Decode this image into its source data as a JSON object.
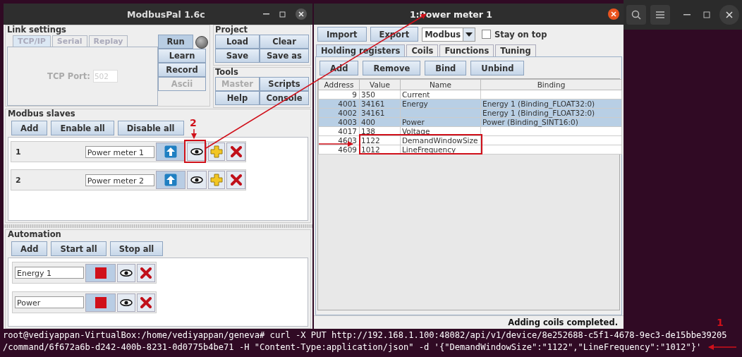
{
  "modbuspal": {
    "title": "ModbusPal 1.6c",
    "link_settings": {
      "title": "Link settings",
      "tabs": [
        {
          "label": "TCP/IP",
          "selected": true
        },
        {
          "label": "Serial",
          "selected": false
        },
        {
          "label": "Replay",
          "selected": false
        }
      ],
      "tcp_port_label": "TCP Port:",
      "tcp_port_value": "502",
      "buttons": [
        {
          "label": "Run",
          "pressed": true,
          "disabled": false
        },
        {
          "label": "Learn",
          "pressed": false,
          "disabled": false
        },
        {
          "label": "Record",
          "pressed": false,
          "disabled": false
        },
        {
          "label": "Ascii",
          "pressed": false,
          "disabled": true
        }
      ]
    },
    "project": {
      "title": "Project",
      "buttons": [
        {
          "label": "Load",
          "disabled": false
        },
        {
          "label": "Clear",
          "disabled": false
        },
        {
          "label": "Save",
          "disabled": false
        },
        {
          "label": "Save as",
          "disabled": false
        }
      ]
    },
    "tools": {
      "title": "Tools",
      "buttons": [
        {
          "label": "Master",
          "disabled": true
        },
        {
          "label": "Scripts",
          "disabled": false
        },
        {
          "label": "Help",
          "disabled": false
        },
        {
          "label": "Console",
          "disabled": false
        }
      ]
    },
    "slaves": {
      "title": "Modbus slaves",
      "buttons": [
        "Add",
        "Enable all",
        "Disable all"
      ],
      "items": [
        {
          "number": "1",
          "name": "Power meter 1"
        },
        {
          "number": "2",
          "name": "Power meter 2"
        }
      ]
    },
    "automation": {
      "title": "Automation",
      "buttons": [
        "Add",
        "Start all",
        "Stop all"
      ],
      "items": [
        {
          "name": "Energy 1"
        },
        {
          "name": "Power"
        }
      ]
    }
  },
  "power_meter": {
    "title": "1:Power meter 1",
    "toolbar": {
      "buttons": [
        "Import",
        "Export"
      ],
      "protocol": "Modbus",
      "stay_on_top": {
        "label": "Stay on top",
        "checked": false
      }
    },
    "tabs": [
      {
        "label": "Holding registers",
        "selected": true
      },
      {
        "label": "Coils",
        "selected": false
      },
      {
        "label": "Functions",
        "selected": false
      },
      {
        "label": "Tuning",
        "selected": false
      }
    ],
    "buttons": [
      "Add",
      "Remove",
      "Bind",
      "Unbind"
    ],
    "table": {
      "columns": [
        "Address",
        "Value",
        "Name",
        "Binding"
      ],
      "rows": [
        {
          "address": "9",
          "value": "350",
          "name": "Current",
          "binding": "",
          "selected": false
        },
        {
          "address": "4001",
          "value": "34161",
          "name": "Energy",
          "binding": "Energy 1 (Binding_FLOAT32:0)",
          "selected": true
        },
        {
          "address": "4002",
          "value": "34161",
          "name": "",
          "binding": "Energy 1 (Binding_FLOAT32:0)",
          "selected": true
        },
        {
          "address": "4003",
          "value": "400",
          "name": "Power",
          "binding": "Power (Binding_SINT16:0)",
          "selected": true
        },
        {
          "address": "4017",
          "value": "138",
          "name": "Voltage",
          "binding": "",
          "selected": false
        },
        {
          "address": "4603",
          "value": "1122",
          "name": "DemandWindowSize",
          "binding": "",
          "selected": false
        },
        {
          "address": "4609",
          "value": "1012",
          "name": "LineFrequency",
          "binding": "",
          "selected": false
        }
      ]
    },
    "status": "Adding coils completed."
  },
  "terminal": {
    "lines": [
      "root@vediyappan-VirtualBox:/home/vediyappan/geneva# curl -X PUT http://192.168.1.100:48082/api/v1/device/8e252688-c5f1-4678-9ec3-de15bbe39205",
      "/command/6f672a6b-d242-400b-8231-0d0775b4be71 -H \"Content-Type:application/json\" -d '{\"DemandWindowSize\":\"1122\",\"LineFrequency\":\"1012\"}'"
    ]
  },
  "annotations": [
    "2",
    "1"
  ]
}
